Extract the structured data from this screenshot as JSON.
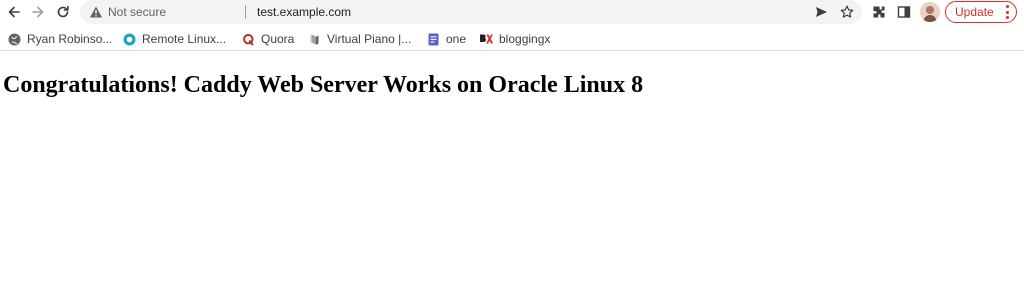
{
  "toolbar": {
    "security_status": "Not secure",
    "url": "test.example.com",
    "update_label": "Update"
  },
  "bookmarks": [
    {
      "label": "Ryan Robinso...",
      "icon": "globe-icon"
    },
    {
      "label": "Remote Linux...",
      "icon": "remote-linux-icon"
    },
    {
      "label": "Quora",
      "icon": "quora-icon"
    },
    {
      "label": "Virtual Piano |...",
      "icon": "piano-icon"
    },
    {
      "label": "one",
      "icon": "docs-icon"
    },
    {
      "label": "bloggingx",
      "icon": "bloggingx-icon"
    }
  ],
  "page": {
    "heading": "Congratulations! Caddy Web Server Works on Oracle Linux 8"
  },
  "colors": {
    "update_accent": "#d93025",
    "omnibox_bg": "#f1f3f4",
    "docs_purple": "#5b5fc7",
    "quora_red": "#b92b27",
    "remote_teal": "#1aa8b8"
  }
}
